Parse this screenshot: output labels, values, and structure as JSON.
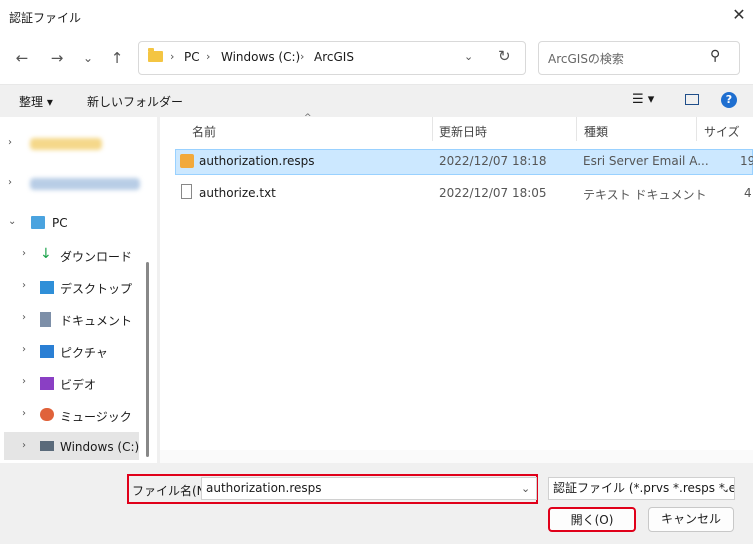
{
  "window": {
    "title": "認証ファイル",
    "close_icon": "close-icon"
  },
  "nav": {
    "back_icon": "←",
    "forward_icon": "→",
    "history_icon": "⌄",
    "up_icon": "↑",
    "breadcrumb": [
      "PC",
      "Windows (C:)",
      "ArcGIS"
    ],
    "refresh_icon": "↻",
    "search_placeholder": "ArcGISの検索"
  },
  "toolbar": {
    "organize_label": "整理 ▾",
    "new_folder_label": "新しいフォルダー"
  },
  "navpane": {
    "items": [
      {
        "label": "PC"
      },
      {
        "label": "ダウンロード"
      },
      {
        "label": "デスクトップ"
      },
      {
        "label": "ドキュメント"
      },
      {
        "label": "ピクチャ"
      },
      {
        "label": "ビデオ"
      },
      {
        "label": "ミュージック"
      },
      {
        "label": "Windows (C:)"
      }
    ]
  },
  "filelist": {
    "columns": [
      "名前",
      "更新日時",
      "種類",
      "サイズ"
    ],
    "rows": [
      {
        "name": "authorization.resps",
        "modified": "2022/12/07 18:18",
        "type": "Esri Server Email A...",
        "size": "19"
      },
      {
        "name": "authorize.txt",
        "modified": "2022/12/07 18:05",
        "type": "テキスト ドキュメント",
        "size": "4"
      }
    ]
  },
  "footer": {
    "filename_label": "ファイル名(N):",
    "filename_value": "authorization.resps",
    "filter_value": "認証ファイル (*.prvs *.resps *.eslf",
    "open_label": "開く(O)",
    "cancel_label": "キャンセル"
  },
  "colors": {
    "highlight": "#e0001a",
    "selection": "#cce8ff"
  }
}
